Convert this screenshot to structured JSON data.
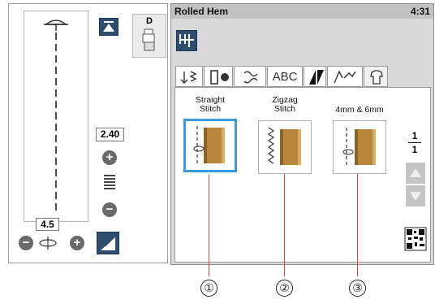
{
  "left_panel": {
    "stitch_width": "2.40",
    "stitch_length": "4.5",
    "foot_code": "D"
  },
  "header": {
    "title": "Rolled Hem",
    "time": "4:31"
  },
  "tabs": [
    {
      "icon": "utility-stitch-icon"
    },
    {
      "icon": "buttonhole-icon"
    },
    {
      "icon": "decorative-stitch-icon"
    },
    {
      "label": "ABC"
    },
    {
      "icon": "quilt-icon"
    },
    {
      "icon": "applique-icon"
    },
    {
      "icon": "garment-icon"
    }
  ],
  "stitches": [
    {
      "line1": "Straight",
      "line2": "Stitch",
      "callout": "①"
    },
    {
      "line1": "Zigzag",
      "line2": "Stitch",
      "callout": "②"
    },
    {
      "line1": "4mm & 6mm",
      "line2": "",
      "callout": "③"
    }
  ],
  "page": {
    "current": "1",
    "total": "1"
  },
  "colors": {
    "fabric": "#b8863b",
    "selected_border": "#3e9ad6",
    "dark_button": "#2f4d6e",
    "pointer": "#e0404a"
  }
}
